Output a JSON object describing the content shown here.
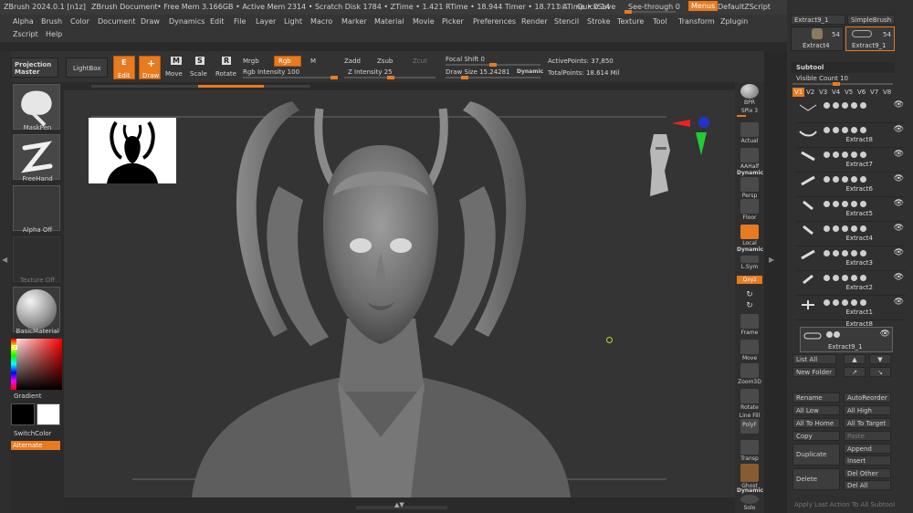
{
  "title_bar": {
    "app": "ZBrush 2024.0.1 [n1z]",
    "doc": "ZBrush Document",
    "stats": "• Free Mem 3.166GB • Active Mem 2314 • Scratch Disk 1784 • ZTime • 1.421 RTime • 18.944 Timer • 18.711 ATime • 0.14",
    "ac": "AC",
    "quicksave": "QuickSave",
    "see_through": "See-through  0",
    "menus": "Menus",
    "default_zscript": "DefaultZScript"
  },
  "menu": {
    "row1": [
      "Alpha",
      "Brush",
      "Color",
      "Document",
      "Draw",
      "Dynamics",
      "Edit",
      "File",
      "Layer",
      "Light",
      "Macro",
      "Marker",
      "Material",
      "Movie",
      "Picker",
      "Preferences",
      "Render",
      "Stencil",
      "Stroke",
      "Texture",
      "Tool",
      "Transform",
      "Zplugin"
    ],
    "row2": [
      "Zscript",
      "Help"
    ]
  },
  "shelf": {
    "projection_master": "Projection Master",
    "lightbox": "LightBox",
    "edit": "Edit",
    "draw": "Draw",
    "move": "Move",
    "scale": "Scale",
    "rotate": "Rotate",
    "mrgb": "Mrgb",
    "rgb": "Rgb",
    "m": "M",
    "rgb_intensity": "Rgb Intensity 100",
    "zadd": "Zadd",
    "zsub": "Zsub",
    "zcut": "Zcut",
    "z_intensity": "Z Intensity 25",
    "focal_shift": "Focal Shift 0",
    "draw_size": "Draw Size 15.24281",
    "dynamic": "Dynamic",
    "active_points": "ActivePoints: 37,850",
    "total_points": "TotalPoints: 18.614 Mil",
    "icon_edit": "E",
    "icon_draw": "+",
    "icon_move": "M",
    "icon_scale": "S",
    "icon_rotate": "R"
  },
  "left": {
    "maskpen": "MaskPen",
    "freehand": "FreeHand",
    "alpha_off": "Alpha Off",
    "texture_off": "Texture Off",
    "basic_material": "BasicMaterial",
    "gradient": "Gradient",
    "switch_color": "SwitchColor",
    "alternate": "Alternate"
  },
  "right_tools": [
    {
      "label": "BPR"
    },
    {
      "label": "SPix 3"
    },
    {
      "label": "Actual"
    },
    {
      "label": "AAHalf"
    },
    {
      "label": "Dynamic"
    },
    {
      "label": "Persp"
    },
    {
      "label": "Floor"
    },
    {
      "label": "Local"
    },
    {
      "label": "Dynamic"
    },
    {
      "label": "L.Sym"
    },
    {
      "label": "Qxyz"
    },
    {
      "label": "Frame"
    },
    {
      "label": "Move"
    },
    {
      "label": "Zoom3D"
    },
    {
      "label": "Rotate"
    },
    {
      "label": "Line Fill"
    },
    {
      "label": "PolyF"
    },
    {
      "label": "Transp"
    },
    {
      "label": "Ghost"
    },
    {
      "label": "Dynamic"
    },
    {
      "label": "Solo"
    }
  ],
  "subtool": {
    "tool_top": [
      {
        "name": "Extract9_1"
      },
      {
        "name": "SimpleBrush"
      }
    ],
    "tool_thumbs": [
      {
        "name": "Extract4",
        "count": "54"
      },
      {
        "name": "Extract9_1",
        "count": "54"
      }
    ],
    "header": "Subtool",
    "visible_count": "Visible Count 10",
    "versions": [
      "V1",
      "V2",
      "V3",
      "V4",
      "V5",
      "V6",
      "V7",
      "V8"
    ],
    "items": [
      {
        "name": ""
      },
      {
        "name": "Extract8"
      },
      {
        "name": "Extract7"
      },
      {
        "name": "Extract6"
      },
      {
        "name": "Extract5"
      },
      {
        "name": "Extract4"
      },
      {
        "name": "Extract3"
      },
      {
        "name": "Extract2"
      },
      {
        "name": "Extract1"
      },
      {
        "name": "Extract8"
      },
      {
        "name": "Extract9_1"
      }
    ],
    "list_all": "List All",
    "new_folder": "New Folder",
    "rename": "Rename",
    "auto_reorder": "AutoReorder",
    "all_low": "All Low",
    "all_high": "All High",
    "all_to_home": "All To Home",
    "all_to_target": "All To Target",
    "copy": "Copy",
    "paste": "Paste",
    "duplicate": "Duplicate",
    "append": "Append",
    "insert": "Insert",
    "delete": "Delete",
    "del_other": "Del Other",
    "del_all": "Del All",
    "apply_last": "Apply Last Action To All Subtool"
  },
  "colors": {
    "accent": "#e87a1f",
    "canvas": "#343434",
    "panel": "#303030"
  }
}
